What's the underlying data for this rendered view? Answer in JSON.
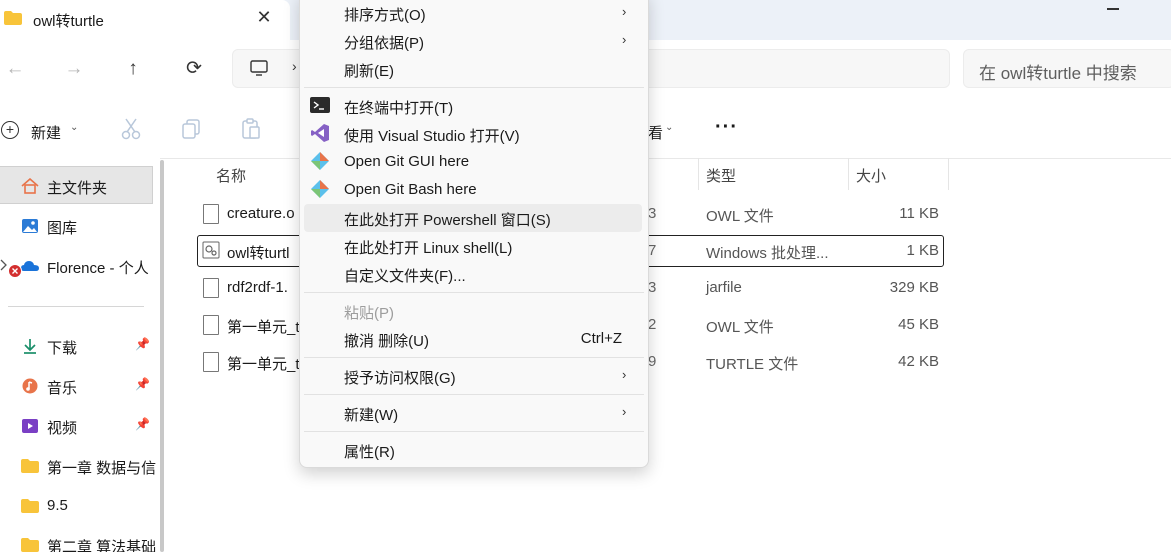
{
  "tab": {
    "title": "owl转turtle",
    "close": "✕"
  },
  "search": {
    "placeholder": "在 owl转turtle 中搜索"
  },
  "nav": {
    "back": "←",
    "forward": "→",
    "up": "↑",
    "refresh": "⟳",
    "chevron": "›"
  },
  "toolbar": {
    "new_label": "新建",
    "more": "···",
    "view_partial": "看"
  },
  "sidebar": {
    "items": [
      {
        "label": "主文件夹",
        "icon": "home-icon"
      },
      {
        "label": "图库",
        "icon": "gallery-icon"
      },
      {
        "label": "Florence - 个人",
        "icon": "onedrive-icon"
      },
      {
        "label": "下载",
        "icon": "download-icon"
      },
      {
        "label": "音乐",
        "icon": "music-icon"
      },
      {
        "label": "视频",
        "icon": "video-icon"
      },
      {
        "label": "第一章 数据与信",
        "icon": "folder-icon"
      },
      {
        "label": "9.5",
        "icon": "folder-icon"
      },
      {
        "label": "第二章 算法基础",
        "icon": "folder-icon"
      }
    ]
  },
  "columns": {
    "name": "名称",
    "type": "类型",
    "size": "大小"
  },
  "files": [
    {
      "name": "creature.o",
      "date": "3",
      "type": "OWL 文件",
      "size": "11 KB"
    },
    {
      "name": "owl转turtl",
      "date": "7",
      "type": "Windows 批处理...",
      "size": "1 KB"
    },
    {
      "name": "rdf2rdf-1.",
      "date": "3",
      "type": "jarfile",
      "size": "329 KB"
    },
    {
      "name": "第一单元_t",
      "date": "2",
      "type": "OWL 文件",
      "size": "45 KB"
    },
    {
      "name": "第一单元_t",
      "date": "9",
      "type": "TURTLE 文件",
      "size": "42 KB"
    }
  ],
  "context_menu": {
    "sort": "排序方式(O)",
    "group": "分组依据(P)",
    "refresh": "刷新(E)",
    "terminal": "在终端中打开(T)",
    "vs": "使用 Visual Studio 打开(V)",
    "git_gui": "Open Git GUI here",
    "git_bash": "Open Git Bash here",
    "powershell": "在此处打开 Powershell 窗口(S)",
    "linux": "在此处打开 Linux shell(L)",
    "customize": "自定义文件夹(F)...",
    "paste": "粘贴(P)",
    "undo": "撤消 删除(U)",
    "undo_shortcut": "Ctrl+Z",
    "grant": "授予访问权限(G)",
    "new": "新建(W)",
    "properties": "属性(R)",
    "submenu_arrow": "›"
  },
  "colors": {
    "accent": "#0067c0",
    "folder": "#f8c43a",
    "highlight": "#ececec"
  }
}
